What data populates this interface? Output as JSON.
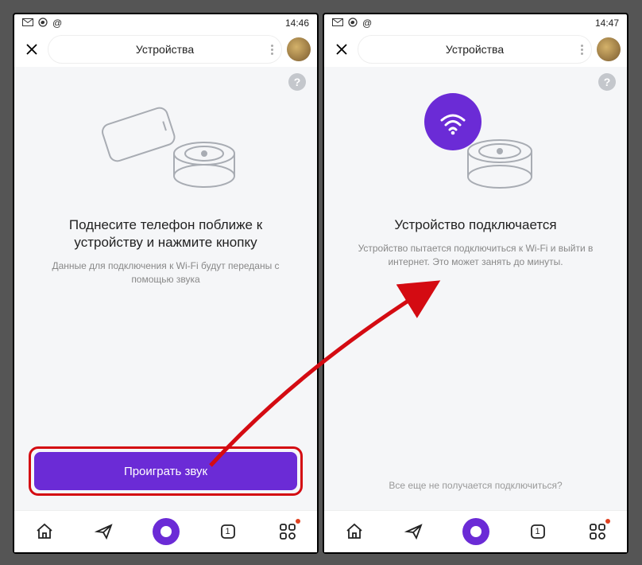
{
  "left": {
    "status": {
      "time": "14:46"
    },
    "header": {
      "title": "Устройства"
    },
    "headline": "Поднесите телефон поближе к устройству и нажмите кнопку",
    "subtext": "Данные для подключения к Wi-Fi будут переданы с помощью звука",
    "button": "Проиграть звук"
  },
  "right": {
    "status": {
      "time": "14:47"
    },
    "header": {
      "title": "Устройства"
    },
    "headline": "Устройство подключается",
    "subtext": "Устройство пытается подключиться к Wi-Fi и выйти в интернет. Это может занять до минуты.",
    "link": "Все еще не получается подключиться?"
  },
  "nav": {
    "square_label": "1"
  },
  "colors": {
    "accent": "#6b2bd6",
    "highlight": "#d40b12"
  }
}
